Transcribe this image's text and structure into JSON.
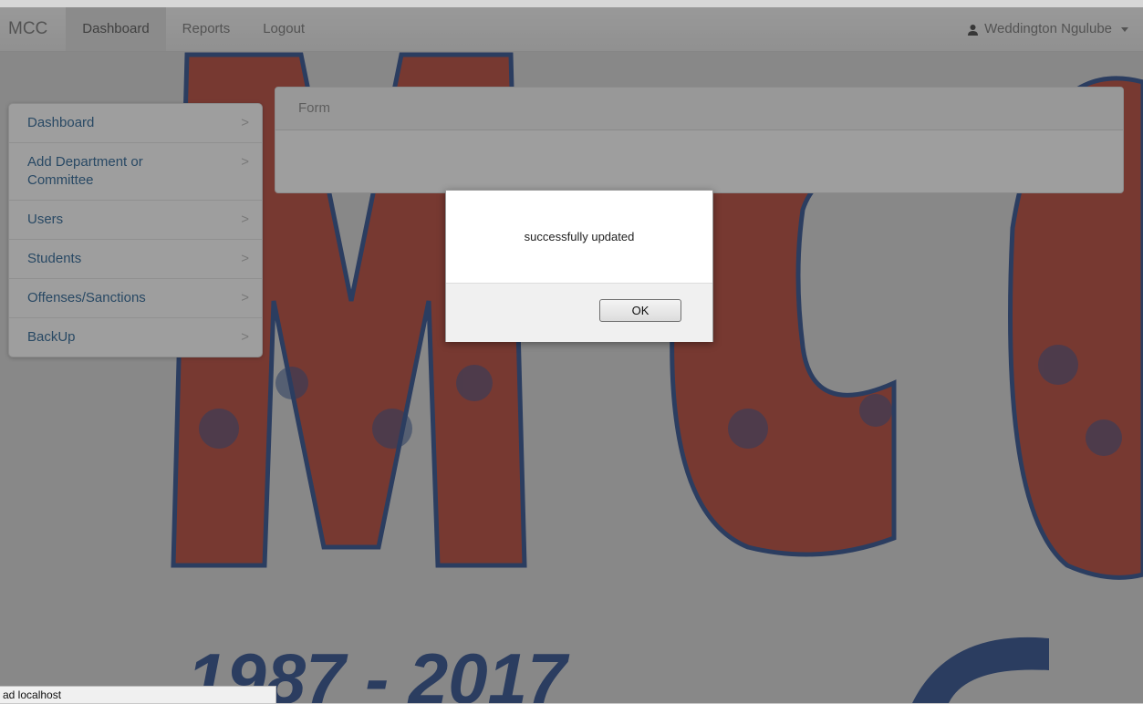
{
  "navbar": {
    "brand": "MCC",
    "items": [
      {
        "label": "Dashboard",
        "active": true
      },
      {
        "label": "Reports"
      },
      {
        "label": "Logout"
      }
    ],
    "user_name": "Weddington Ngulube"
  },
  "sidebar": {
    "items": [
      {
        "label": "Dashboard"
      },
      {
        "label": "Add Department or Committee"
      },
      {
        "label": "Users"
      },
      {
        "label": "Students"
      },
      {
        "label": "Offenses/Sanctions"
      },
      {
        "label": "BackUp"
      }
    ]
  },
  "panel": {
    "heading": "Form"
  },
  "background": {
    "year_text": "1987 - 2017"
  },
  "dialog": {
    "message": "successfully updated",
    "ok_label": "OK"
  },
  "statusbar": {
    "text": "ad localhost"
  },
  "colors": {
    "link": "#2a6496",
    "banner_red": "#d8432f",
    "banner_blue": "#2f4f8f"
  }
}
